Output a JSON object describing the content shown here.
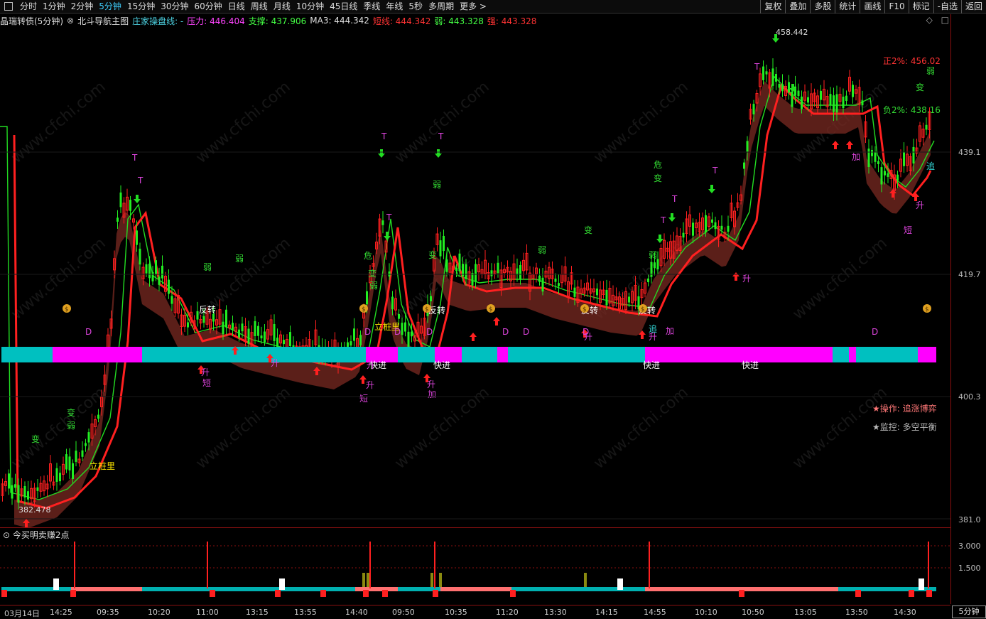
{
  "toolbar": {
    "periods": [
      "分时",
      "1分钟",
      "2分钟",
      "5分钟",
      "15分钟",
      "30分钟",
      "60分钟",
      "日线",
      "周线",
      "月线",
      "10分钟",
      "45日线",
      "季线",
      "年线",
      "5秒",
      "多周期",
      "更多 >"
    ],
    "active_period": "5分钟",
    "right_buttons": [
      "复权",
      "叠加",
      "多股",
      "统计",
      "画线",
      "F10",
      "标记",
      "-自选",
      "返回"
    ]
  },
  "info": {
    "stock": "晶瑞转债(5分钟)",
    "close_glyph": "⊗",
    "indicator_name": "北斗导航主图",
    "sub_name": "庄家操盘线: -",
    "pressure": "压力: 446.404",
    "support": "支撑: 437.906",
    "ma3": "MA3: 444.342",
    "short": "短线: 444.342",
    "weak": "弱: 443.328",
    "strong": "强: 443.328",
    "ctrl1": "◇",
    "ctrl2": "□"
  },
  "axis": {
    "price_labels": [
      "439.1",
      "419.7",
      "400.3",
      "381.0"
    ],
    "sub_labels": [
      "3.000",
      "1.500"
    ],
    "max_marker": "458.442",
    "min_marker": "382.478",
    "pos2": "正2%: 456.02",
    "neg2": "负2%: 438.16"
  },
  "side_notes": {
    "operation": "★操作: 追涨博弈",
    "monitor": "★监控: 多空平衡"
  },
  "sub_chart": {
    "title": "今买明卖赚2点"
  },
  "time_axis": [
    "03月14日",
    "14:25",
    "09:35",
    "10:20",
    "11:00",
    "13:15",
    "13:55",
    "14:40",
    "09:50",
    "10:35",
    "11:20",
    "13:30",
    "14:15",
    "14:55",
    "10:10",
    "10:50",
    "13:05",
    "13:50",
    "14:30"
  ],
  "period_corner": "5分钟",
  "chart_labels": [
    {
      "t": "立桩里",
      "c": "#ffe800"
    },
    {
      "t": "立桩里",
      "c": "#ffe800"
    },
    {
      "t": "反转",
      "c": "#ffffff"
    },
    {
      "t": "反转",
      "c": "#ffffff"
    },
    {
      "t": "反转",
      "c": "#ffffff"
    },
    {
      "t": "反转",
      "c": "#ffffff"
    },
    {
      "t": "快进",
      "c": "#ffffff"
    },
    {
      "t": "快进",
      "c": "#ffffff"
    },
    {
      "t": "快进",
      "c": "#ffffff"
    },
    {
      "t": "快进",
      "c": "#ffffff"
    },
    {
      "t": "变",
      "c": "#33dd33"
    },
    {
      "t": "弱",
      "c": "#33dd33"
    },
    {
      "t": "危",
      "c": "#33dd33"
    },
    {
      "t": "升",
      "c": "#dd44dd"
    },
    {
      "t": "短",
      "c": "#dd44dd"
    },
    {
      "t": "加",
      "c": "#dd44dd"
    },
    {
      "t": "追",
      "c": "#33dddd"
    },
    {
      "t": "T",
      "c": "#dd44dd"
    },
    {
      "t": "D",
      "c": "#dd44dd"
    }
  ]
}
